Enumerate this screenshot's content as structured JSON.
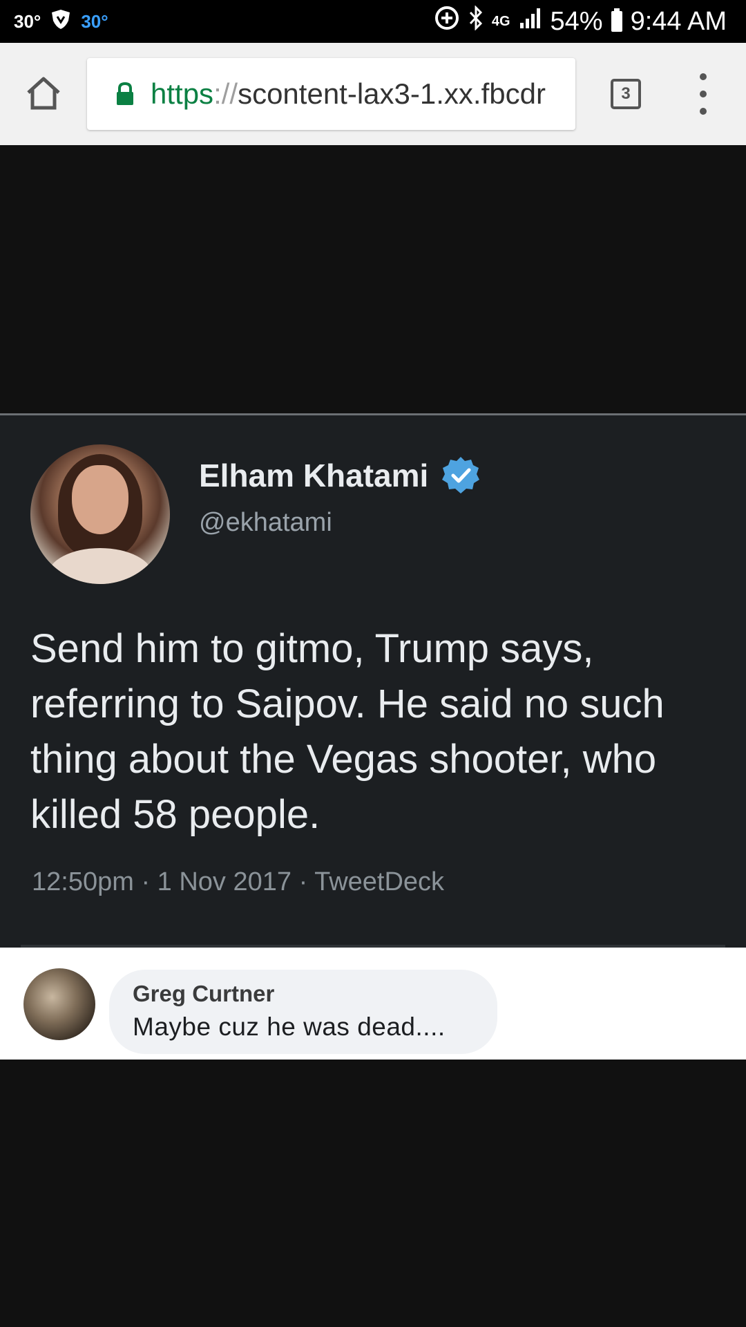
{
  "status_bar": {
    "temp_left": "30°",
    "temp_right": "30°",
    "network": "4G",
    "battery": "54%",
    "time": "9:44 AM"
  },
  "browser": {
    "url_scheme": "https",
    "url_sep": "://",
    "url_host": "scontent-lax3-1.xx.fbcdr",
    "tab_count": "3"
  },
  "tweet": {
    "author_name": "Elham Khatami",
    "handle": "@ekhatami",
    "text": "Send him to gitmo, Trump says, referring to Saipov. He said no such thing about the Vegas shooter, who killed 58 people.",
    "meta": "12:50pm · 1 Nov 2017 · TweetDeck"
  },
  "comment": {
    "author": "Greg Curtner",
    "text": "Maybe cuz he was dead...."
  },
  "colors": {
    "status_bar_bg": "#000000",
    "browser_bar_bg": "#f1f1f1",
    "url_scheme": "#0b8043",
    "tweet_bg": "#1c1f22",
    "verified_badge": "#4ea3e0",
    "page_bg": "#111111"
  }
}
